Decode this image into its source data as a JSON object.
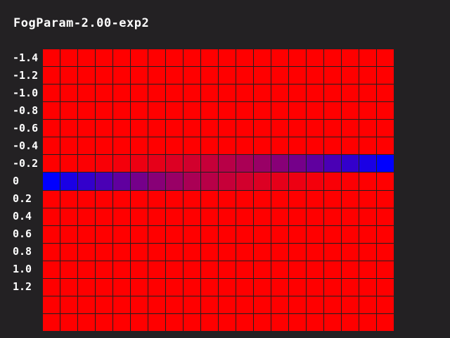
{
  "title": "FogParam-2.00-exp2",
  "row_labels": [
    "-1.4",
    "-1.2",
    "-1.0",
    "-0.8",
    "-0.6",
    "-0.4",
    "-0.2",
    "0",
    "0.2",
    "0.4",
    "0.6",
    "0.8",
    "1.0",
    "1.2"
  ],
  "grid": {
    "rows": 16,
    "columns": 20,
    "base_color": "#ff0000",
    "fog_color": "#0000ff",
    "gradient_rows": [
      {
        "row_index": 6,
        "direction": "left-to-right"
      },
      {
        "row_index": 7,
        "direction": "right-to-left"
      }
    ]
  },
  "colors": {
    "background": "#232123",
    "gridline": "#202020",
    "text": "#ffffff"
  }
}
